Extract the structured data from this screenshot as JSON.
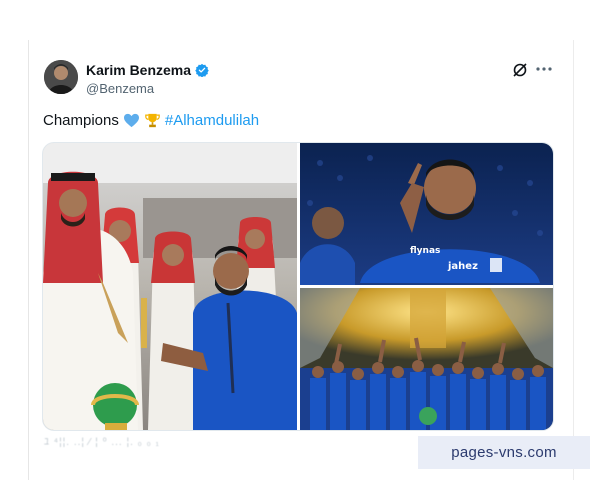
{
  "tweet": {
    "author_name": "Karim Benzema",
    "handle": "@Benzema",
    "text_prefix": "Champions",
    "hashtag": "#Alhamdulilah",
    "heart_icon": "blue-heart-icon",
    "trophy_icon": "trophy-icon",
    "verified_icon": "verified-badge-icon",
    "accent_color": "#1d9bf0",
    "footer_text": "ﾕ ⁴¦¦. ..¦ ⁄ ¦ ⁰ ... ¦. ₀ ₀ ₁"
  },
  "media": {
    "photos": [
      {
        "icon": "ceremony-photo"
      },
      {
        "icon": "celebration-photo",
        "jersey": [
          "flynas",
          "jahez"
        ]
      },
      {
        "icon": "team-trophy-photo"
      }
    ]
  },
  "watermark": {
    "text": "pages-vns.com"
  }
}
